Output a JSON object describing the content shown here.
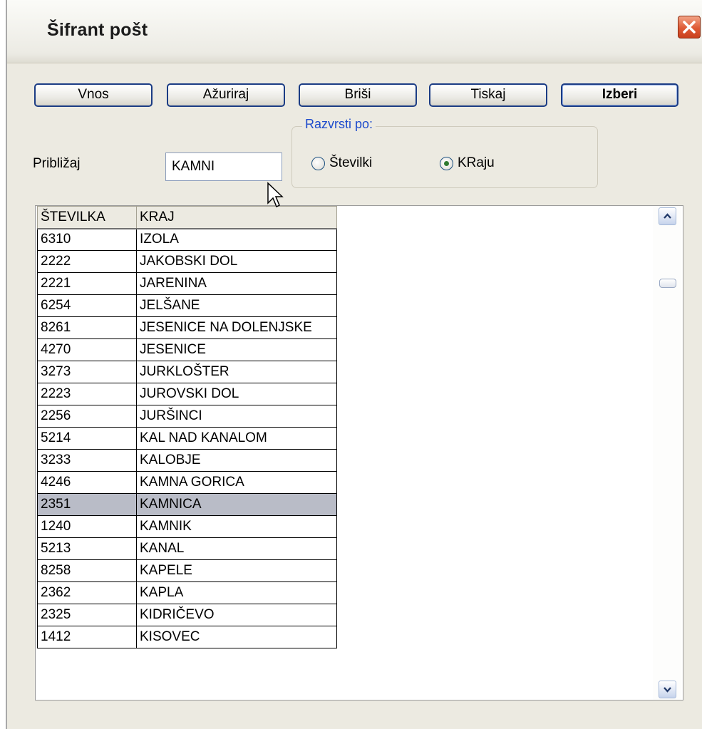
{
  "window": {
    "title": "Šifrant pošt"
  },
  "toolbar": {
    "vnos": "Vnos",
    "azuriraj": "Ažuriraj",
    "brisi": "Briši",
    "tiskaj": "Tiskaj",
    "izberi": "Izberi"
  },
  "search": {
    "label": "Približaj",
    "value": "KAMNI"
  },
  "sort": {
    "legend": "Razvrsti po:",
    "options": [
      {
        "label": "Številki",
        "checked": false
      },
      {
        "label": "KRaju",
        "checked": true
      }
    ]
  },
  "grid": {
    "columns": [
      "ŠTEVILKA",
      "KRAJ"
    ],
    "rows": [
      [
        "6310",
        "IZOLA"
      ],
      [
        "2222",
        "JAKOBSKI DOL"
      ],
      [
        "2221",
        "JARENINA"
      ],
      [
        "6254",
        "JELŠANE"
      ],
      [
        "8261",
        "JESENICE NA DOLENJSKE"
      ],
      [
        "4270",
        "JESENICE"
      ],
      [
        "3273",
        "JURKLOŠTER"
      ],
      [
        "2223",
        "JUROVSKI DOL"
      ],
      [
        "2256",
        "JURŠINCI"
      ],
      [
        "5214",
        "KAL NAD KANALOM"
      ],
      [
        "3233",
        "KALOBJE"
      ],
      [
        "4246",
        "KAMNA GORICA"
      ],
      [
        "2351",
        "KAMNICA"
      ],
      [
        "1240",
        "KAMNIK"
      ],
      [
        "5213",
        "KANAL"
      ],
      [
        "8258",
        "KAPELE"
      ],
      [
        "2362",
        "KAPLA"
      ],
      [
        "2325",
        "KIDRIČEVO"
      ],
      [
        "1412",
        "KISOVEC"
      ]
    ],
    "selected_row": 12
  },
  "icons": {
    "close": "close-icon",
    "scroll_up": "chevron-up-icon",
    "scroll_down": "chevron-down-icon",
    "cursor": "mouse-pointer-icon"
  },
  "colors": {
    "title_bar": "#f4f3ee",
    "close_button": "#df5a35",
    "button_border": "#1b3c84",
    "legend_text": "#1d4bcc",
    "selected_row": "#b9bcc7",
    "window_bg": "#eceae1"
  }
}
